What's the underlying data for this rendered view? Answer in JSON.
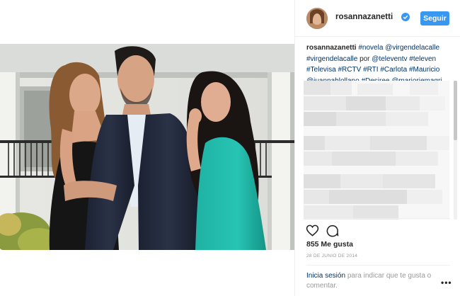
{
  "header": {
    "username": "rosannazanetti",
    "follow_label": "Seguir",
    "verified_icon": "verified-badge-icon",
    "accent": "#3897f0"
  },
  "caption": {
    "owner": "rosannazanetti",
    "tags": [
      "#novela",
      "@virgendelacalle",
      "#virgendelacalle",
      "por",
      "@televentv",
      "#televen",
      "#Televisa",
      "#RCTV",
      "#RTI",
      "#Carlota",
      "#Mauricio",
      "@juanpablollano",
      "#Desiree",
      "@marjoriemagri"
    ]
  },
  "post": {
    "likes": "855 Me gusta",
    "date": "28 DE JUNIO DE 2014"
  },
  "icons": {
    "like": "heart-icon",
    "comment": "comment-icon",
    "more": "more-options-icon"
  },
  "comment_prompt": {
    "link": "Inicia sesión",
    "rest": "para indicar que te gusta o comentar."
  },
  "more_label": "•••"
}
